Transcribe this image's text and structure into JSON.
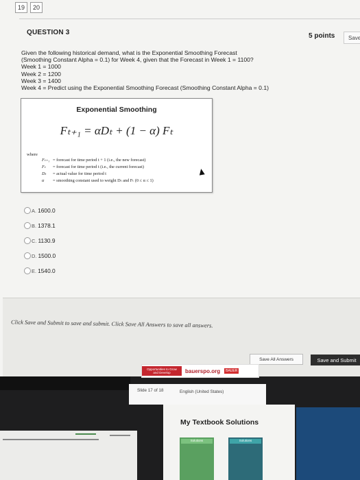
{
  "pager": {
    "pages": [
      "19",
      "20"
    ]
  },
  "question": {
    "title": "QUESTION 3",
    "points": "5 points",
    "save_label": "Save",
    "lines": [
      "Given the following historical demand, what is the Exponential Smoothing Forecast",
      "(Smoothing Constant Alpha = 0.1) for Week 4, given that the Forecast in Week 1 = 1100?",
      "Week 1 = 1000",
      "Week 2 = 1200",
      "Week 3 = 1400",
      "Week 4 = Predict using the Exponential Smoothing Forecast (Smoothing Constant Alpha = 0.1)"
    ]
  },
  "figure": {
    "title": "Exponential Smoothing",
    "formula": "Fₜ₊₁ = αDₜ + (1 − α) Fₜ",
    "where": "where",
    "definitions": [
      {
        "sym": "Fₜ₊₁",
        "text": "= forecast for time period t + 1 (i.e., the new forecast)"
      },
      {
        "sym": "Fₜ",
        "text": "= forecast for time period t (i.e., the current forecast)"
      },
      {
        "sym": "Dₜ",
        "text": "= actual value for time period t"
      },
      {
        "sym": "α",
        "text": "= smoothing constant used to weight Dₜ and Fₜ (0 ≤ α ≤ 1)"
      }
    ]
  },
  "options": [
    {
      "letter": "A.",
      "value": "1600.0"
    },
    {
      "letter": "B.",
      "value": "1378.1"
    },
    {
      "letter": "C.",
      "value": "1130.9"
    },
    {
      "letter": "D.",
      "value": "1500.0"
    },
    {
      "letter": "E.",
      "value": "1540.0"
    }
  ],
  "footer": {
    "instruction": "Click Save and Submit to save and submit. Click Save All Answers to save all answers.",
    "save_all": "Save All Answers",
    "save_submit": "Save and Submit"
  },
  "slideshow": {
    "ad_text": "Opportunities to Grow and Develop",
    "ad_site": "bauerspo.org",
    "ad_brand": "BAUER",
    "slide": "Slide 17 of 18",
    "language": "English (United States)",
    "textbook_title": "My Textbook Solutions",
    "card_label": "Solutions"
  }
}
